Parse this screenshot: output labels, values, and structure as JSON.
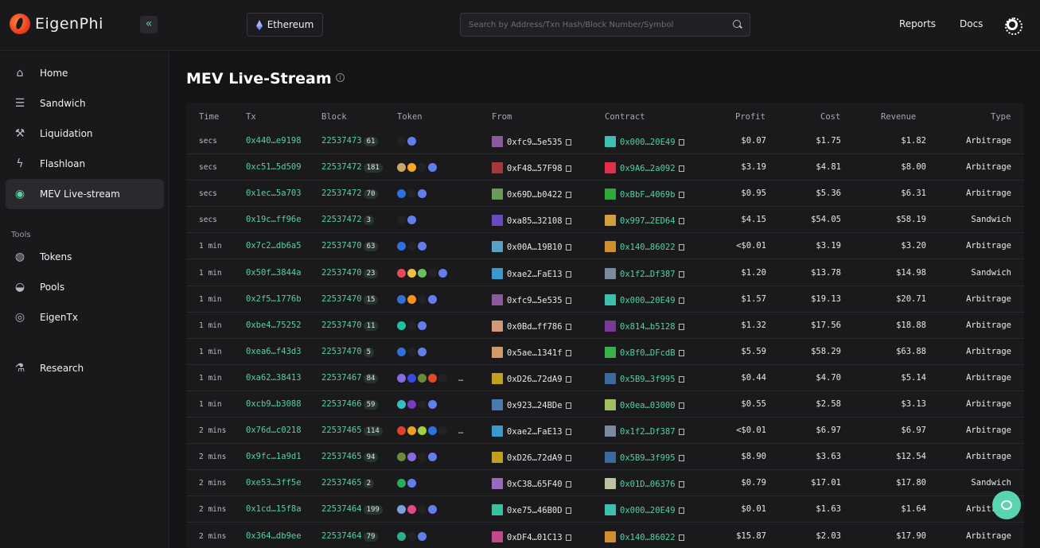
{
  "header": {
    "logo_text": "EigenPhi",
    "collapse_glyph": "«",
    "chain": "Ethereum",
    "search_placeholder": "Search by Address/Txn Hash/Block Number/Symbol",
    "nav": [
      "Reports",
      "Docs"
    ]
  },
  "sidebar": {
    "items": [
      {
        "label": "Home",
        "icon": "home-icon"
      },
      {
        "label": "Sandwich",
        "icon": "sandwich-icon"
      },
      {
        "label": "Liquidation",
        "icon": "gavel-icon"
      },
      {
        "label": "Flashloan",
        "icon": "bolt-icon"
      },
      {
        "label": "MEV Live-stream",
        "icon": "livestream-icon",
        "active": true
      }
    ],
    "tools_label": "Tools",
    "tools": [
      {
        "label": "Tokens",
        "icon": "tokens-icon"
      },
      {
        "label": "Pools",
        "icon": "pools-icon"
      },
      {
        "label": "EigenTx",
        "icon": "eigentx-icon"
      }
    ],
    "research": {
      "label": "Research",
      "icon": "research-icon"
    }
  },
  "main": {
    "title": "MEV Live-Stream",
    "columns": [
      "Time",
      "Tx",
      "Block",
      "Token",
      "From",
      "Contract",
      "Profit",
      "Cost",
      "Revenue",
      "Type"
    ],
    "rows": [
      {
        "time": "secs",
        "tx": "0x440…e9198",
        "block": "22537473",
        "count": "61",
        "tokens": [
          "#222",
          "#627eea"
        ],
        "from": "0xfc9…5e535",
        "from_color": "#8a5a9a",
        "contract": "0x000…20E49",
        "contract_color": "#3fbfb0",
        "profit": "$0.07",
        "cost": "$1.75",
        "revenue": "$1.82",
        "type": "Arbitrage"
      },
      {
        "time": "secs",
        "tx": "0xc51…5d509",
        "block": "22537472",
        "count": "181",
        "tokens": [
          "#c9a86a",
          "#f5a623",
          "#222",
          "#627eea"
        ],
        "from": "0xF48…57F98",
        "from_color": "#a33a3a",
        "contract": "0x9A6…2a092",
        "contract_color": "#e0304a",
        "profit": "$3.19",
        "cost": "$4.81",
        "revenue": "$8.00",
        "type": "Arbitrage"
      },
      {
        "time": "secs",
        "tx": "0x1ec…5a703",
        "block": "22537472",
        "count": "70",
        "tokens": [
          "#2f6fe0",
          "#222",
          "#627eea"
        ],
        "from": "0x69D…b0422",
        "from_color": "#6a9a5a",
        "contract": "0xBbF…4069b",
        "contract_color": "#2eaa3a",
        "profit": "$0.95",
        "cost": "$5.36",
        "revenue": "$6.31",
        "type": "Arbitrage"
      },
      {
        "time": "secs",
        "tx": "0x19c…ff96e",
        "block": "22537472",
        "count": "3",
        "tokens": [
          "#222",
          "#627eea"
        ],
        "from": "0xa85…32108",
        "from_color": "#6a4ac0",
        "contract": "0x997…2ED64",
        "contract_color": "#d0a040",
        "profit": "$4.15",
        "cost": "$54.05",
        "revenue": "$58.19",
        "type": "Sandwich"
      },
      {
        "time": "1 min",
        "tx": "0x7c2…db6a5",
        "block": "22537470",
        "count": "63",
        "tokens": [
          "#2f6fe0",
          "#222",
          "#627eea"
        ],
        "from": "0x00A…19B10",
        "from_color": "#5aa0c0",
        "contract": "0x140…86022",
        "contract_color": "#d09030",
        "profit": "<$0.01",
        "cost": "$3.19",
        "revenue": "$3.20",
        "type": "Arbitrage"
      },
      {
        "time": "1 min",
        "tx": "0x50f…3844a",
        "block": "22537470",
        "count": "23",
        "tokens": [
          "#e84a5a",
          "#f0c040",
          "#6ac060",
          "#222",
          "#627eea"
        ],
        "from": "0xae2…FaE13",
        "from_color": "#3a9ad0",
        "contract": "0x1f2…Df387",
        "contract_color": "#7a8aa0",
        "profit": "$1.20",
        "cost": "$13.78",
        "revenue": "$14.98",
        "type": "Sandwich"
      },
      {
        "time": "1 min",
        "tx": "0x2f5…1776b",
        "block": "22537470",
        "count": "15",
        "tokens": [
          "#2f6fe0",
          "#f7931a",
          "#222",
          "#627eea"
        ],
        "from": "0xfc9…5e535",
        "from_color": "#8a5a9a",
        "contract": "0x000…20E49",
        "contract_color": "#3fbfb0",
        "profit": "$1.57",
        "cost": "$19.13",
        "revenue": "$20.71",
        "type": "Arbitrage"
      },
      {
        "time": "1 min",
        "tx": "0xbe4…75252",
        "block": "22537470",
        "count": "11",
        "tokens": [
          "#20c0a0",
          "#222",
          "#627eea"
        ],
        "from": "0x0Bd…ff786",
        "from_color": "#d09a7a",
        "contract": "0x814…b5128",
        "contract_color": "#7a3a9a",
        "profit": "$1.32",
        "cost": "$17.56",
        "revenue": "$18.88",
        "type": "Arbitrage"
      },
      {
        "time": "1 min",
        "tx": "0xea6…f43d3",
        "block": "22537470",
        "count": "5",
        "tokens": [
          "#2f6fe0",
          "#222",
          "#627eea"
        ],
        "from": "0x5ae…1341f",
        "from_color": "#d09a6a",
        "contract": "0xBf0…DFcdB",
        "contract_color": "#3ab04a",
        "profit": "$5.59",
        "cost": "$58.29",
        "revenue": "$63.88",
        "type": "Arbitrage"
      },
      {
        "time": "1 min",
        "tx": "0xa62…38413",
        "block": "22537467",
        "count": "84",
        "tokens": [
          "#8a6ae0",
          "#3a4ae0",
          "#6a8a3a",
          "#e04a2a",
          "#222"
        ],
        "from": "0xD26…72dA9",
        "from_color": "#c0a020",
        "contract": "0x5B9…3f995",
        "contract_color": "#3a6aa0",
        "profit": "$0.44",
        "cost": "$4.70",
        "revenue": "$5.14",
        "type": "Arbitrage",
        "more": "…"
      },
      {
        "time": "1 min",
        "tx": "0xcb9…b3088",
        "block": "22537466",
        "count": "59",
        "tokens": [
          "#30c0c0",
          "#7a3ac0",
          "#222",
          "#627eea"
        ],
        "from": "0x923…24BDe",
        "from_color": "#4a7ab0",
        "contract": "0x0ea…03000",
        "contract_color": "#a0c060",
        "profit": "$0.55",
        "cost": "$2.58",
        "revenue": "$3.13",
        "type": "Arbitrage"
      },
      {
        "time": "2 mins",
        "tx": "0x76d…c0218",
        "block": "22537465",
        "count": "114",
        "tokens": [
          "#e0402a",
          "#f0a020",
          "#a0d040",
          "#2f6fe0",
          "#222"
        ],
        "from": "0xae2…FaE13",
        "from_color": "#3a9ad0",
        "contract": "0x1f2…Df387",
        "contract_color": "#7a8aa0",
        "profit": "<$0.01",
        "cost": "$6.97",
        "revenue": "$6.97",
        "type": "Arbitrage",
        "more": "…"
      },
      {
        "time": "2 mins",
        "tx": "0x9fc…1a9d1",
        "block": "22537465",
        "count": "94",
        "tokens": [
          "#6a8a3a",
          "#8a6ae0",
          "#222",
          "#627eea"
        ],
        "from": "0xD26…72dA9",
        "from_color": "#c0a020",
        "contract": "0x5B9…3f995",
        "contract_color": "#3a6aa0",
        "profit": "$8.90",
        "cost": "$3.63",
        "revenue": "$12.54",
        "type": "Arbitrage"
      },
      {
        "time": "2 mins",
        "tx": "0xe53…3ff5e",
        "block": "22537465",
        "count": "2",
        "tokens": [
          "#2aaa5a",
          "#627eea"
        ],
        "from": "0xC38…65F40",
        "from_color": "#9a6ac0",
        "contract": "0x01D…06376",
        "contract_color": "#c0c0a0",
        "profit": "$0.79",
        "cost": "$17.01",
        "revenue": "$17.80",
        "type": "Sandwich"
      },
      {
        "time": "2 mins",
        "tx": "0x1cd…15f8a",
        "block": "22537464",
        "count": "199",
        "tokens": [
          "#7aa0e0",
          "#e04a8a",
          "#222",
          "#627eea"
        ],
        "from": "0xe75…46B0D",
        "from_color": "#3ac0a0",
        "contract": "0x000…20E49",
        "contract_color": "#3fbfb0",
        "profit": "$0.01",
        "cost": "$1.63",
        "revenue": "$1.64",
        "type": "Arbitrage"
      },
      {
        "time": "2 mins",
        "tx": "0x364…db9ee",
        "block": "22537464",
        "count": "79",
        "tokens": [
          "#2ab090",
          "#222",
          "#627eea"
        ],
        "from": "0xDF4…01C13",
        "from_color": "#c04a8a",
        "contract": "0x140…86022",
        "contract_color": "#d09030",
        "profit": "$15.87",
        "cost": "$2.03",
        "revenue": "$17.90",
        "type": "Arbitrage"
      }
    ]
  }
}
